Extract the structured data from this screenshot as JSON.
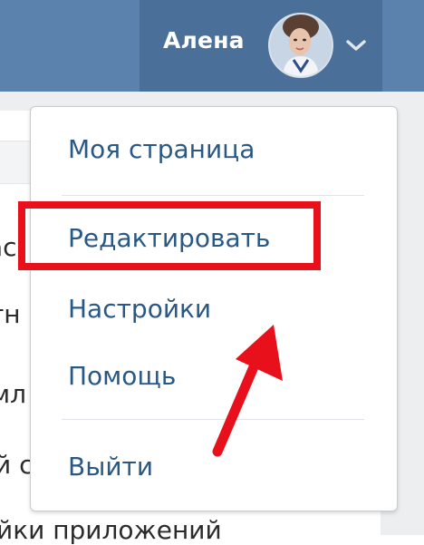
{
  "header": {
    "user_name": "Алена"
  },
  "menu": {
    "items": [
      {
        "label": "Моя страница"
      },
      {
        "label": "Редактировать"
      },
      {
        "label": "Настройки"
      },
      {
        "label": "Помощь"
      },
      {
        "label": "Выйти"
      }
    ]
  },
  "background": {
    "fragments": [
      "ас",
      "тн",
      "мл",
      "й с",
      "йки приложений"
    ]
  },
  "colors": {
    "header_bg": "#5b82ad",
    "header_active_bg": "#4a6f98",
    "menu_text": "#2a5885",
    "annotation_red": "#e8101a"
  },
  "icons": {
    "avatar": "avatar-photo",
    "dropdown": "chevron-down-icon",
    "annotation_arrow": "red-arrow-icon"
  }
}
